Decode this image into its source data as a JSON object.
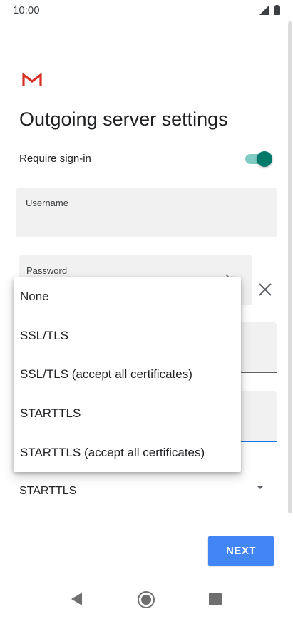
{
  "status_bar": {
    "time": "10:00",
    "icons": [
      "signal-icon",
      "battery-icon"
    ]
  },
  "header": {
    "logo": "gmail-logo",
    "title": "Outgoing server settings"
  },
  "require_signin": {
    "label": "Require sign-in",
    "enabled": true
  },
  "fields": {
    "username": {
      "label": "Username",
      "value": ""
    },
    "password": {
      "label": "Password",
      "value": ""
    }
  },
  "security": {
    "selected": "STARTTLS",
    "options": [
      "None",
      "SSL/TLS",
      "SSL/TLS (accept all certificates)",
      "STARTTLS",
      "STARTTLS (accept all certificates)"
    ]
  },
  "footer": {
    "next_label": "NEXT"
  },
  "colors": {
    "accent": "#4285f4",
    "toggle": "#00796b",
    "gmail_red": "#d93025"
  },
  "nav": [
    "back-icon",
    "home-icon",
    "recents-icon"
  ]
}
